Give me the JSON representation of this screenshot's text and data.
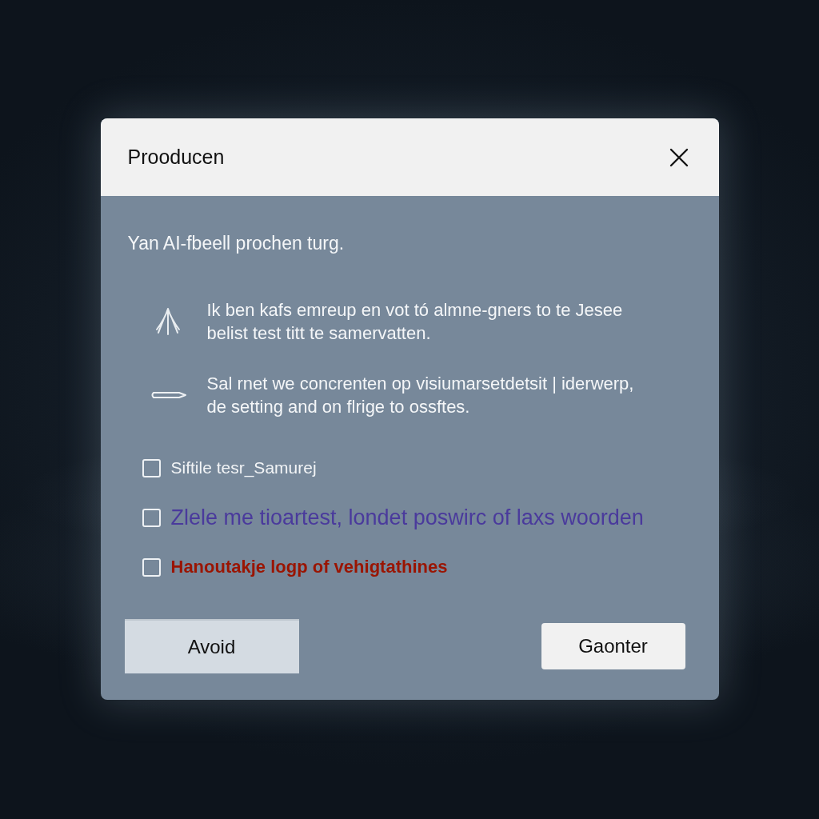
{
  "dialog": {
    "title": "Prooducen"
  },
  "intro": "Yan AI-fbeell prochen turg.",
  "points": [
    "Ik ben kafs emreup en vot tó almne-gners to te Jesee belist test titt te samervatten.",
    "Sal rnet we concrenten op visiumarsetdetsit | iderwerp, de setting and on flrige to ossftes."
  ],
  "checklist": [
    {
      "label": "Siftile tesr_Samurej",
      "checked": false,
      "color": "#f2f4f6"
    },
    {
      "label": "Zlele me tioartest, londet poswirc of laxs woorden",
      "checked": false,
      "color": "#4a3a9c"
    },
    {
      "label": "Hanoutakje logp of vehigtathines",
      "checked": false,
      "color": "#9a1400"
    }
  ],
  "buttons": [
    {
      "label": "Avoid",
      "kind": "flat"
    },
    {
      "label": "Gaonter",
      "kind": "raised"
    }
  ]
}
